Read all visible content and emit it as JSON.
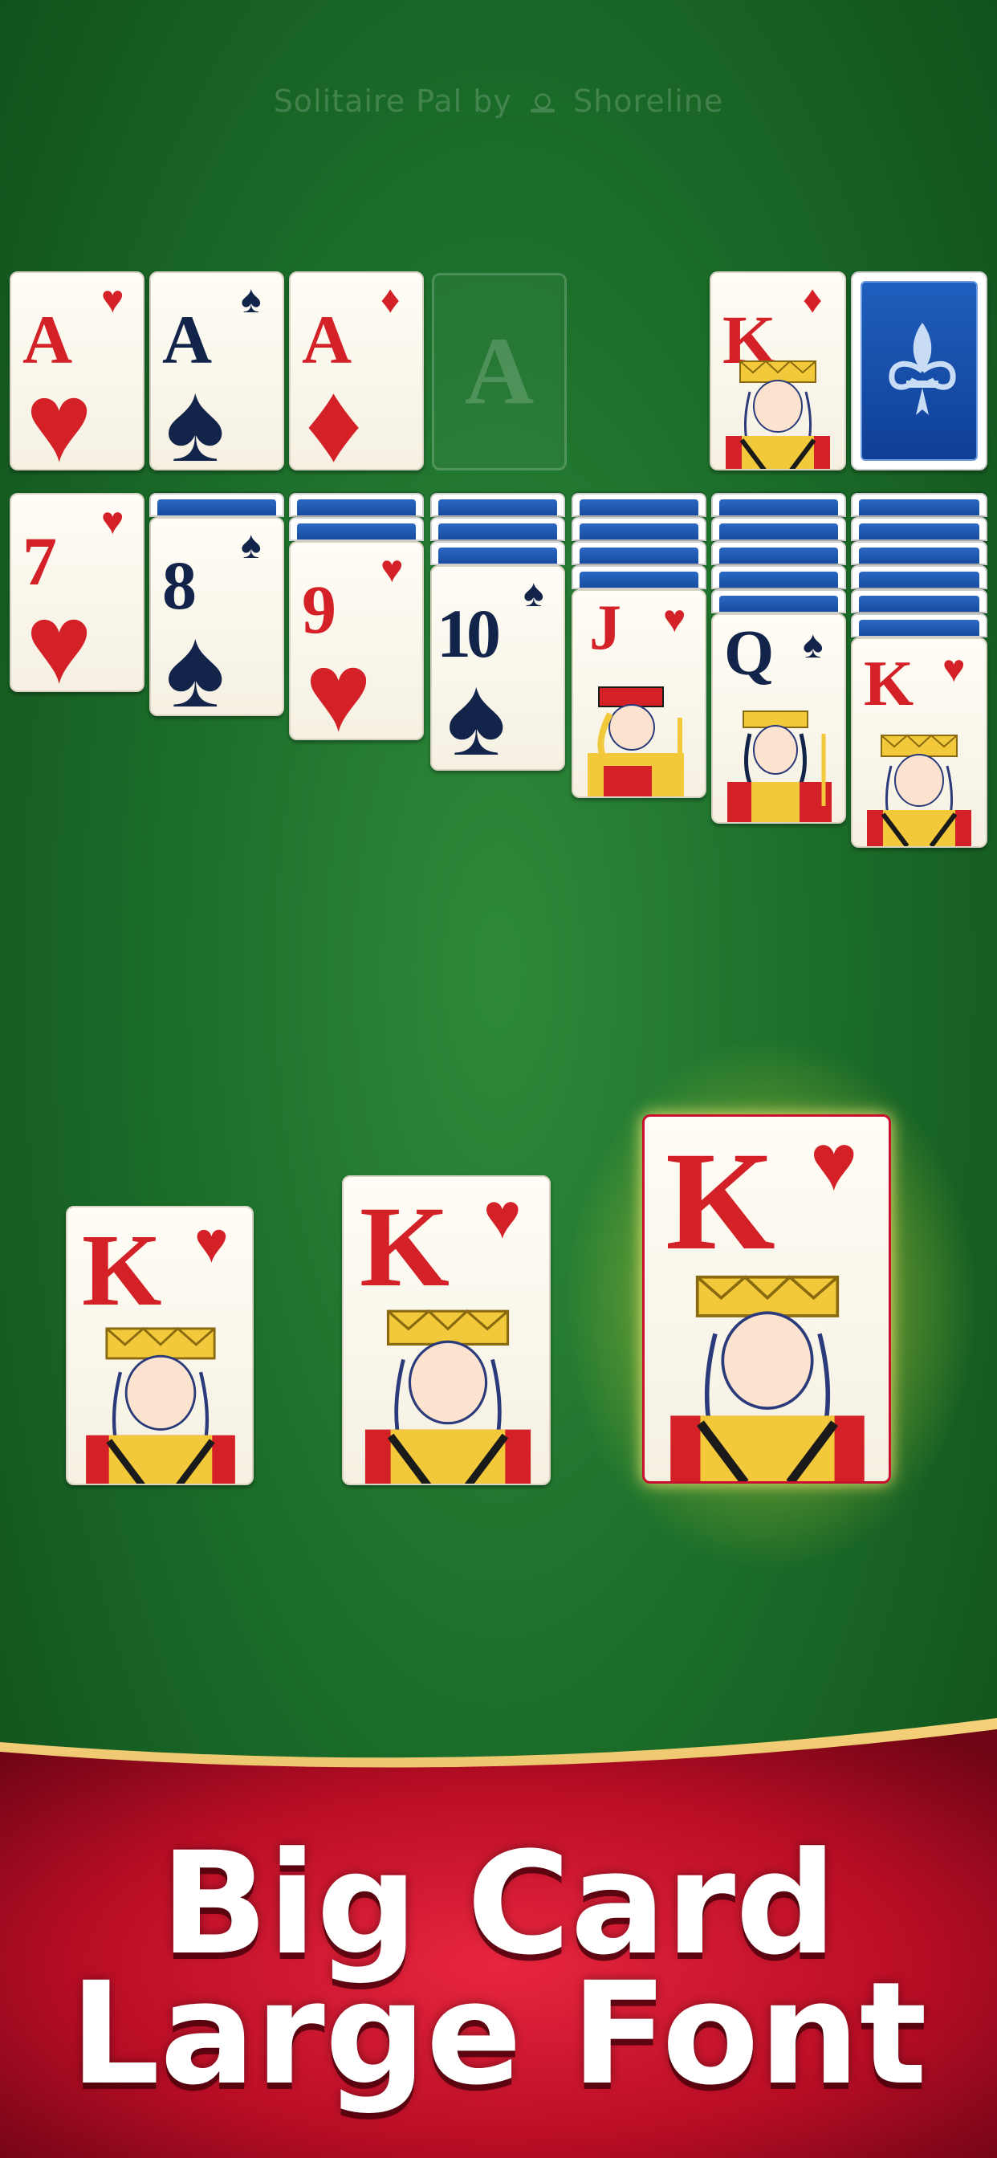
{
  "watermark": {
    "brand_left": "Solitaire Pal by",
    "brand_right": "Shoreline",
    "logo_icon": "ship-wheel-icon"
  },
  "foundations": [
    {
      "rank": "A",
      "suit": "♥",
      "color": "red"
    },
    {
      "rank": "A",
      "suit": "♠",
      "color": "black"
    },
    {
      "rank": "A",
      "suit": "♦",
      "color": "red"
    },
    {
      "rank": "A",
      "suit": "",
      "color": "empty"
    }
  ],
  "waste": {
    "rank": "K",
    "suit": "♦",
    "color": "red"
  },
  "stock": {
    "icon": "fleur-de-lis-icon"
  },
  "tableau": [
    {
      "rank": "7",
      "suit": "♥",
      "color": "red",
      "face_down": 0
    },
    {
      "rank": "8",
      "suit": "♠",
      "color": "black",
      "face_down": 1
    },
    {
      "rank": "9",
      "suit": "♥",
      "color": "red",
      "face_down": 2
    },
    {
      "rank": "10",
      "suit": "♠",
      "color": "black",
      "face_down": 3
    },
    {
      "rank": "J",
      "suit": "♥",
      "color": "red",
      "face_down": 4
    },
    {
      "rank": "Q",
      "suit": "♠",
      "color": "black",
      "face_down": 5
    },
    {
      "rank": "K",
      "suit": "♥",
      "color": "red",
      "face_down": 6
    }
  ],
  "showcase": [
    {
      "rank": "K",
      "suit": "♥",
      "highlighted": false
    },
    {
      "rank": "K",
      "suit": "♥",
      "highlighted": false
    },
    {
      "rank": "K",
      "suit": "♥",
      "highlighted": true
    }
  ],
  "banner": {
    "line1": "Big Card",
    "line2": "Large Font"
  },
  "colors": {
    "felt": "#1c6e2a",
    "red_suit": "#d42027",
    "black_suit": "#13244a",
    "banner_red": "#c8102e",
    "gold_trim": "#d8a640"
  }
}
